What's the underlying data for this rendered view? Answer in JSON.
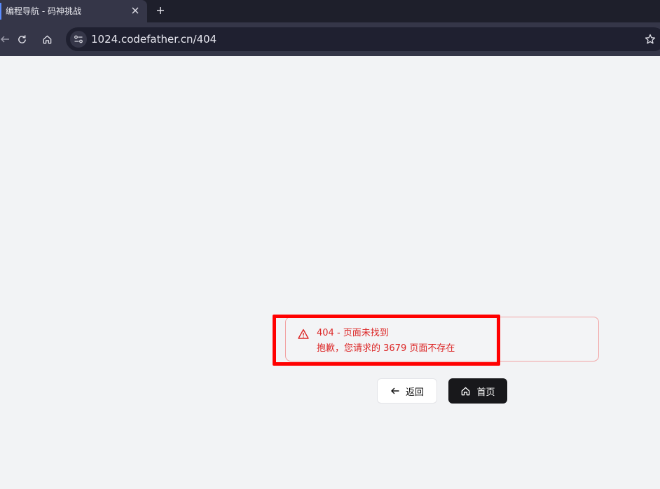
{
  "browser": {
    "tab_title": "编程导航 - 码神挑战",
    "url": "1024.codefather.cn/404"
  },
  "alert": {
    "title": "404 - 页面未找到",
    "description": "抱歉，您请求的 3679 页面不存在",
    "color": "#dc2626"
  },
  "actions": {
    "back_label": "返回",
    "home_label": "首页"
  },
  "annotation": {
    "highlight_color": "#ff0000"
  }
}
